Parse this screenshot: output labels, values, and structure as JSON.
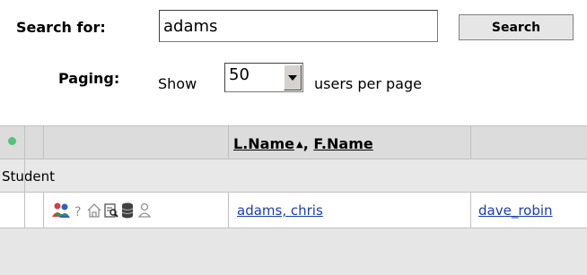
{
  "search": {
    "label": "Search for:",
    "value": "adams",
    "button_label": "Search"
  },
  "paging": {
    "label": "Paging:",
    "show_text": "Show",
    "page_size": "50",
    "suffix": "users per page"
  },
  "table": {
    "header": {
      "last_name": "L.Name",
      "sort_indicator": "▲",
      "separator": ", ",
      "first_name": "F.Name"
    },
    "group": "Student",
    "rows": [
      {
        "icons": [
          "users-icon",
          "help-icon",
          "home-icon",
          "view-profile-icon",
          "database-icon",
          "person-icon"
        ],
        "name": "adams, chris",
        "contact": "dave_robin"
      }
    ]
  },
  "colors": {
    "status_dot": "#59c07a",
    "link": "#1a3db0",
    "header_bg": "#dcdcdc"
  }
}
